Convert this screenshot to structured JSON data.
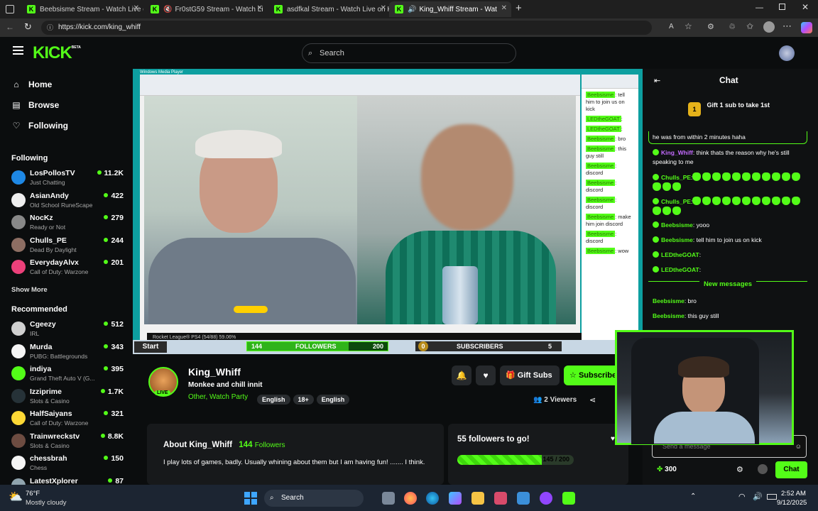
{
  "browser": {
    "tabs": [
      {
        "label": "Beebsisme Stream - Watch Live o"
      },
      {
        "label": "Fr0stG59 Stream - Watch Li"
      },
      {
        "label": "asdfkal Stream - Watch Live on K"
      },
      {
        "label": "King_Whiff Stream - Watch I"
      }
    ],
    "url": "https://kick.com/king_whiff",
    "new_tab": "+"
  },
  "header": {
    "logo": "KICK",
    "logo_badge": "BETA",
    "search_placeholder": "Search"
  },
  "sidebar": {
    "nav": [
      {
        "label": "Home",
        "icon": "home-icon"
      },
      {
        "label": "Browse",
        "icon": "browse-icon"
      },
      {
        "label": "Following",
        "icon": "heart-icon"
      }
    ],
    "following_title": "Following",
    "following": [
      {
        "name": "LosPollosTV",
        "category": "Just Chatting",
        "viewers": "11.2K",
        "color": "#1e88e5"
      },
      {
        "name": "AsianAndy",
        "category": "Old School RuneScape",
        "viewers": "422",
        "color": "#eeeeee"
      },
      {
        "name": "NocKz",
        "category": "Ready or Not",
        "viewers": "279",
        "color": "#888888"
      },
      {
        "name": "Chulls_PE",
        "category": "Dead By Daylight",
        "viewers": "244",
        "color": "#8d6e63"
      },
      {
        "name": "EverydayAlvx",
        "category": "Call of Duty: Warzone",
        "viewers": "201",
        "color": "#ec407a"
      }
    ],
    "show_more": "Show More",
    "recommended_title": "Recommended",
    "recommended": [
      {
        "name": "Cgeezy",
        "category": "IRL",
        "viewers": "512",
        "color": "#d0d0d0"
      },
      {
        "name": "Murda",
        "category": "PUBG: Battlegrounds",
        "viewers": "343",
        "color": "#f5f5f5"
      },
      {
        "name": "indiya",
        "category": "Grand Theft Auto V (G...",
        "viewers": "395",
        "color": "#53fc18"
      },
      {
        "name": "Izziprime",
        "category": "Slots & Casino",
        "viewers": "1.7K",
        "color": "#263238"
      },
      {
        "name": "HalfSaiyans",
        "category": "Call of Duty: Warzone",
        "viewers": "321",
        "color": "#fdd835"
      },
      {
        "name": "Trainwreckstv",
        "category": "Slots & Casino",
        "viewers": "8.8K",
        "color": "#6d4c41"
      },
      {
        "name": "chessbrah",
        "category": "Chess",
        "viewers": "150",
        "color": "#f5f5f5"
      },
      {
        "name": "LatestXplorer",
        "category": "",
        "viewers": "87",
        "color": "#90a4ae"
      }
    ]
  },
  "video": {
    "player_title": "Windows Media Player",
    "gamebar_text": "Rocket League® PS4  (54/88) 59.06%",
    "start": "Start",
    "followers_label": "FOLLOWERS",
    "followers_current": "144",
    "followers_goal": "200",
    "followers_progress": 0.72,
    "subs_label": "SUBSCRIBERS",
    "subs_current": "0",
    "subs_goal": "5",
    "chat_lines": [
      {
        "user": "Beebsisme",
        "text": ": tell him to join us on kick"
      },
      {
        "user": "LEDtheGOAT",
        "text": ":"
      },
      {
        "user": "LEDtheGOAT",
        "text": ":"
      },
      {
        "user": "Beebsisme",
        "text": ": bro"
      },
      {
        "user": "Beebsisme",
        "text": ": this guy still"
      },
      {
        "user": "Beebsisme",
        "text": ": discord"
      },
      {
        "user": "Beebsisme",
        "text": ": discord"
      },
      {
        "user": "Beebsisme",
        "text": ": discord"
      },
      {
        "user": "Beebsisme",
        "text": ": make him join discord"
      },
      {
        "user": "Beebsisme",
        "text": ": discord"
      },
      {
        "user": "Beebsisme",
        "text": ": wow"
      }
    ]
  },
  "channel": {
    "name": "King_Whiff",
    "live": "LIVE",
    "title": "Monkee and chill innit",
    "categories": "Other, Watch Party",
    "tags": [
      "English",
      "18+",
      "English"
    ],
    "gift_subs": "Gift Subs",
    "subscribe": "Subscribe",
    "viewers": "2 Viewers",
    "about_title": "About King_Whiff",
    "followers": "144",
    "followers_label": "Followers",
    "about_text": "I play lots of games, badly. Usually whining about them but I am having fun! ....... I think.",
    "goal_title": "55 followers to go!",
    "goal_progress": "145 / 200",
    "goal_fraction": 0.725
  },
  "chat": {
    "title": "Chat",
    "gift_banner": "Gift 1 sub to take 1st",
    "gift_rank": "1",
    "messages": [
      {
        "user": "",
        "text": "he was from within 2 minutes haha",
        "color": "#ffffff"
      },
      {
        "user": "King_Whiff",
        "text": ": think thats the reason why he's still speaking to me",
        "color": "#c46bff"
      },
      {
        "user": "Chulls_PE",
        "text": ":",
        "color": "#53fc18",
        "emotes": 14
      },
      {
        "user": "Chulls_PE",
        "text": ":",
        "color": "#53fc18",
        "emotes": 14
      },
      {
        "user": "Beebsisme",
        "text": ": yooo",
        "color": "#53fc18"
      },
      {
        "user": "Beebsisme",
        "text": ": tell him to join us on kick",
        "color": "#53fc18"
      },
      {
        "user": "LEDtheGOAT",
        "text": ":",
        "color": "#53fc18"
      },
      {
        "user": "LEDtheGOAT",
        "text": ":",
        "color": "#53fc18"
      }
    ],
    "new_messages": "New messages",
    "new_msgs": [
      {
        "user": "Beebsisme",
        "text": ": bro"
      },
      {
        "user": "Beebsisme",
        "text": ": this guy still"
      }
    ],
    "input_placeholder": "Send a message",
    "points": "300",
    "send": "Chat"
  },
  "taskbar": {
    "weather_temp": "76°F",
    "weather_desc": "Mostly cloudy",
    "search": "Search",
    "time": "2:52 AM",
    "date": "9/12/2025"
  }
}
